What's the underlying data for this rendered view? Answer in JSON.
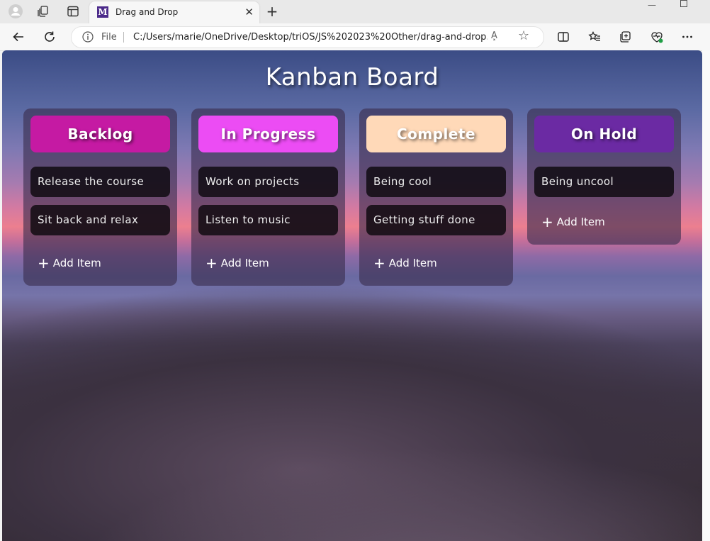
{
  "browser": {
    "tab_title": "Drag and Drop",
    "tab_favicon_letter": "M",
    "address_prefix": "File",
    "url": "C:/Users/marie/OneDrive/Desktop/triOS/JS%202023%20Other/drag-and-drop...",
    "read_aloud": "A͓",
    "icons": [
      "profile-icon",
      "workspaces-icon",
      "tab-actions-icon",
      "close-icon",
      "new-tab-icon",
      "back-icon",
      "refresh-icon",
      "info-icon",
      "read-aloud-icon",
      "favorite-star-icon",
      "split-screen-icon",
      "favorites-icon",
      "collections-icon",
      "browser-essentials-icon",
      "more-icon"
    ]
  },
  "board": {
    "title": "Kanban Board",
    "add_label": "Add Item",
    "columns": [
      {
        "name": "Backlog",
        "color": "#c51aa3",
        "items": [
          "Release the course",
          "Sit back and relax"
        ]
      },
      {
        "name": "In Progress",
        "color": "#ec4cf4",
        "items": [
          "Work on projects",
          "Listen to music"
        ]
      },
      {
        "name": "Complete",
        "color": "#ffd9b8",
        "items": [
          "Being cool",
          "Getting stuff done"
        ]
      },
      {
        "name": "On Hold",
        "color": "#6b2aa3",
        "items": [
          "Being uncool"
        ]
      }
    ]
  }
}
